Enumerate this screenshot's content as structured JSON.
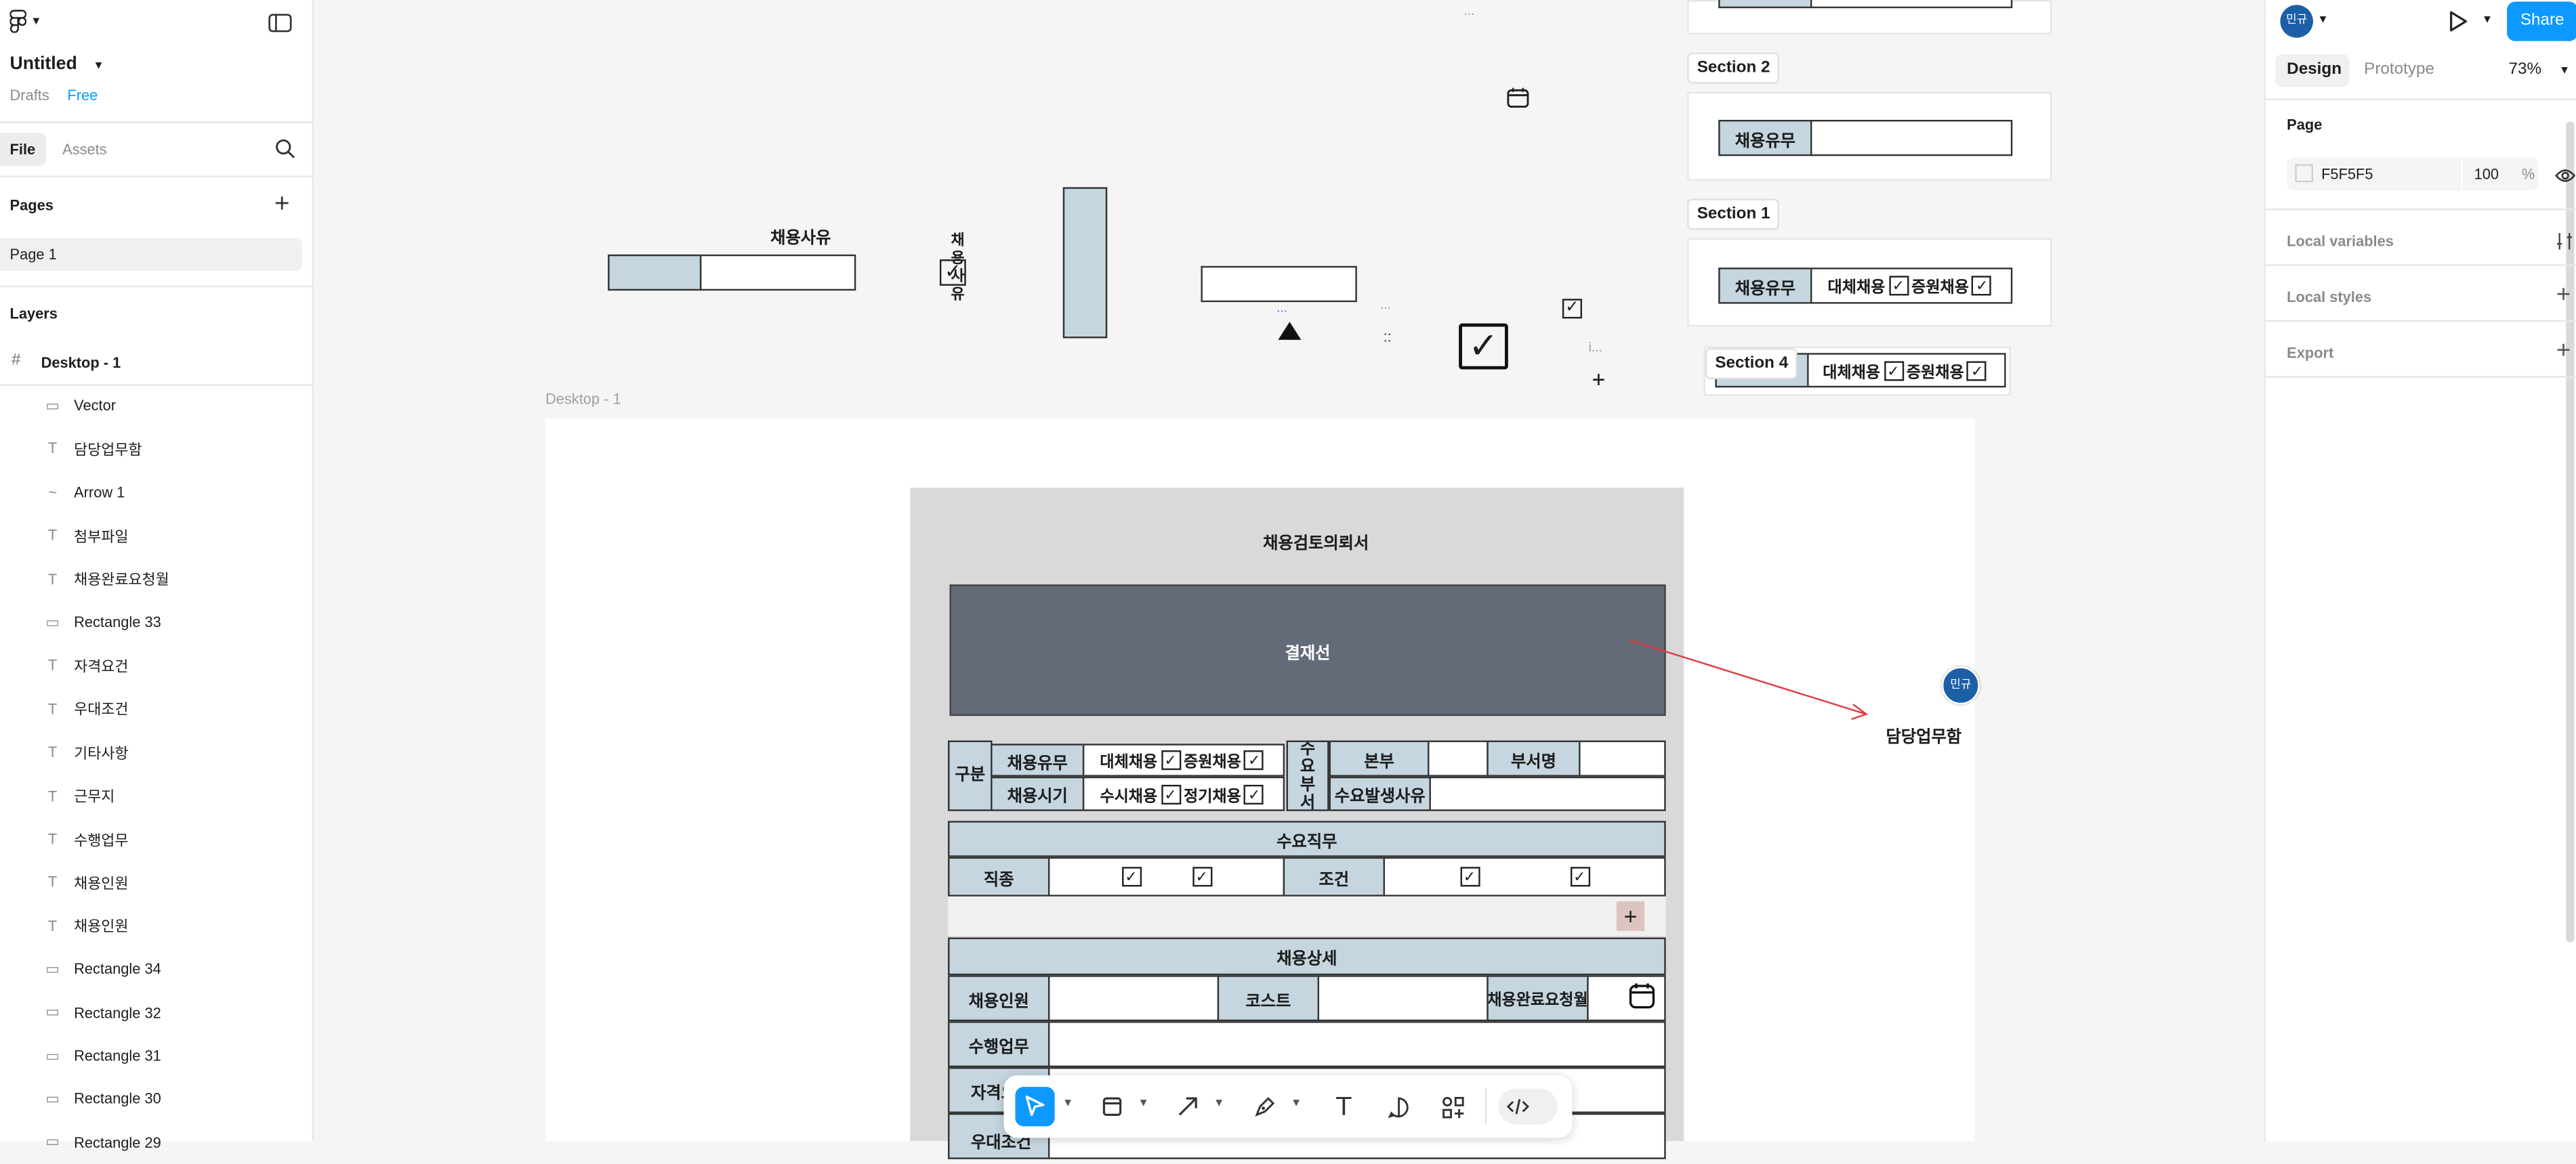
{
  "app": {
    "file_name": "Untitled",
    "location": "Drafts",
    "plan_badge": "Free"
  },
  "left_panel": {
    "tabs": [
      "File",
      "Assets"
    ],
    "pages_heading": "Pages",
    "pages": [
      "Page 1"
    ],
    "layers_heading": "Layers",
    "frame": "Desktop - 1",
    "layers": [
      {
        "icon": "calendar-icon",
        "glyph": "▭",
        "name": "Vector"
      },
      {
        "icon": "text-icon",
        "glyph": "T",
        "name": "담당업무함"
      },
      {
        "icon": "arrow-icon",
        "glyph": "~",
        "name": "Arrow 1"
      },
      {
        "icon": "text-icon",
        "glyph": "T",
        "name": "첨부파일"
      },
      {
        "icon": "text-icon",
        "glyph": "T",
        "name": "채용완료요청월"
      },
      {
        "icon": "rectangle-icon",
        "glyph": "▭",
        "name": "Rectangle 33"
      },
      {
        "icon": "text-icon",
        "glyph": "T",
        "name": "자격요건"
      },
      {
        "icon": "text-icon",
        "glyph": "T",
        "name": "우대조건"
      },
      {
        "icon": "text-icon",
        "glyph": "T",
        "name": "기타사항"
      },
      {
        "icon": "text-icon",
        "glyph": "T",
        "name": "근무지"
      },
      {
        "icon": "text-icon",
        "glyph": "T",
        "name": "수행업무"
      },
      {
        "icon": "text-icon",
        "glyph": "T",
        "name": "채용인원"
      },
      {
        "icon": "text-icon",
        "glyph": "T",
        "name": "채용인원"
      },
      {
        "icon": "rectangle-icon",
        "glyph": "▭",
        "name": "Rectangle 34"
      },
      {
        "icon": "rectangle-icon",
        "glyph": "▭",
        "name": "Rectangle 32"
      },
      {
        "icon": "rectangle-icon",
        "glyph": "▭",
        "name": "Rectangle 31"
      },
      {
        "icon": "rectangle-icon",
        "glyph": "▭",
        "name": "Rectangle 30"
      },
      {
        "icon": "rectangle-icon",
        "glyph": "▭",
        "name": "Rectangle 29"
      }
    ]
  },
  "right_panel": {
    "avatar": "민규",
    "share": "Share",
    "tabs": [
      "Design",
      "Prototype"
    ],
    "zoom": "73%",
    "page_heading": "Page",
    "page_color": "F5F5F5",
    "page_opacity": "100",
    "percent": "%",
    "sections": [
      "Local variables",
      "Local styles",
      "Export"
    ]
  },
  "canvas": {
    "frame_label": "Desktop - 1",
    "loose": {
      "reason_label": "채용사유",
      "reason_vertical": "채용사유",
      "dots1": "...",
      "dots2": "...",
      "dots3": "...",
      "dots4": "i...",
      "grip": "::",
      "plus": "+"
    },
    "sections": [
      {
        "label": "Section 2",
        "row": {
          "head": "채용유무",
          "body": ""
        }
      },
      {
        "label": "Section 1",
        "row": {
          "head": "채용유무",
          "opt1": "대체채용",
          "opt2": "증원채용"
        }
      },
      {
        "label": "Section 4",
        "row": {
          "opt1": "대체채용",
          "opt2": "증원채용"
        }
      }
    ],
    "form": {
      "title": "채용검토의뢰서",
      "approval": "결재선",
      "gubun": "구분",
      "hire_yn": "채용유무",
      "hire_yn_opt1": "대체채용",
      "hire_yn_opt2": "증원채용",
      "hire_time": "채용시기",
      "hire_time_opt1": "수시채용",
      "hire_time_opt2": "정기채용",
      "demand_dept": "수요부서",
      "hq": "본부",
      "dept_name": "부서명",
      "demand_reason": "수요발생사유",
      "demand_job": "수요직무",
      "job_type": "직종",
      "condition": "조건",
      "hire_detail": "채용상세",
      "headcount": "채용인원",
      "cost": "코스트",
      "complete_month": "채용완료요청월",
      "duties": "수행업무",
      "qualification": "자격요건",
      "preferred": "우대조건"
    },
    "comment": {
      "avatar": "민규",
      "label": "담당업무함"
    }
  },
  "colors": {
    "accent": "#0d99ff",
    "header_cell": "#c5d6e0",
    "approval_fill": "#636b78",
    "arrow": "#e0393e"
  }
}
